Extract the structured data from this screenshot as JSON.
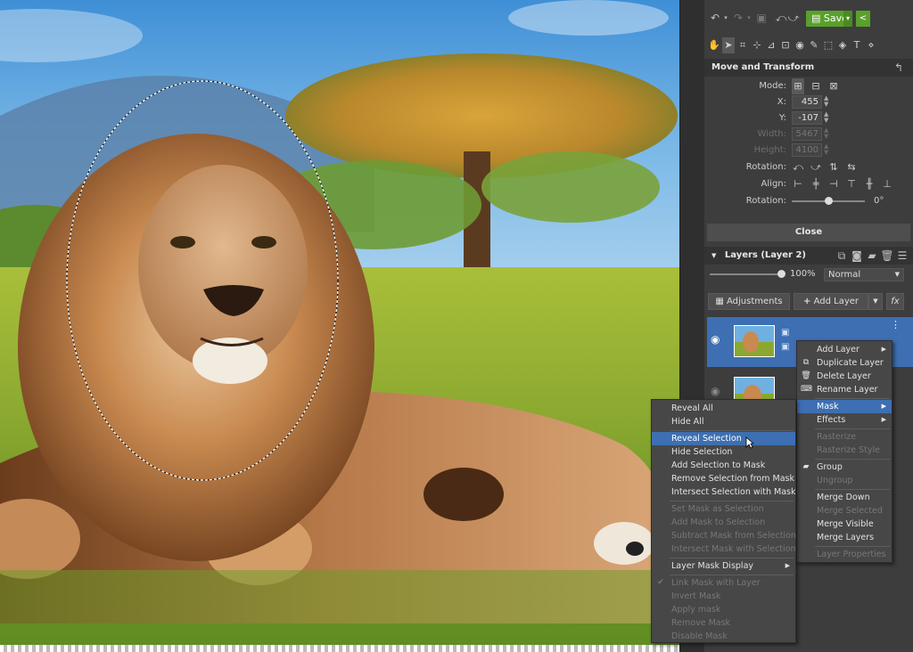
{
  "toolbar": {
    "save_label": "Save",
    "undo_icon": "undo-icon",
    "redo_icon": "redo-icon",
    "share_icon": "share-icon"
  },
  "move_transform": {
    "title": "Move and Transform",
    "mode_label": "Mode:",
    "x_label": "X:",
    "x_value": "455",
    "y_label": "Y:",
    "y_value": "-107",
    "width_label": "Width:",
    "width_value": "5467",
    "height_label": "Height:",
    "height_value": "4100",
    "rotation_label": "Rotation:",
    "align_label": "Align:",
    "rotation_slider_label": "Rotation:",
    "rotation_value": "0°",
    "rotation_level": 0.5,
    "close_label": "Close"
  },
  "layers": {
    "title": "Layers (Layer 2)",
    "opacity": "100%",
    "opacity_level": 1.0,
    "blend_mode": "Normal",
    "adjustments_label": "Adjustments",
    "add_layer_label": "Add Layer",
    "fx_label": "fx"
  },
  "context_menu": {
    "items": [
      {
        "label": "Add Layer",
        "submenu": true,
        "enabled": true
      },
      {
        "label": "Duplicate Layer",
        "enabled": true
      },
      {
        "label": "Delete Layer",
        "enabled": true
      },
      {
        "label": "Rename Layer",
        "enabled": true
      },
      {
        "label": "Mask",
        "submenu": true,
        "enabled": true,
        "highlighted": true
      },
      {
        "label": "Effects",
        "submenu": true,
        "enabled": true
      },
      {
        "label": "Rasterize",
        "enabled": false
      },
      {
        "label": "Rasterize Style",
        "enabled": false
      },
      {
        "label": "Group",
        "enabled": true
      },
      {
        "label": "Ungroup",
        "enabled": false
      },
      {
        "label": "Merge Down",
        "enabled": true
      },
      {
        "label": "Merge Selected",
        "enabled": false
      },
      {
        "label": "Merge Visible",
        "enabled": true
      },
      {
        "label": "Merge Layers",
        "enabled": true
      },
      {
        "label": "Layer Properties",
        "enabled": false
      }
    ]
  },
  "mask_menu": {
    "items": [
      {
        "label": "Reveal All",
        "enabled": true
      },
      {
        "label": "Hide All",
        "enabled": true
      },
      {
        "label": "Reveal Selection",
        "enabled": true,
        "highlighted": true
      },
      {
        "label": "Hide Selection",
        "enabled": true
      },
      {
        "label": "Add Selection to Mask",
        "enabled": true
      },
      {
        "label": "Remove Selection from Mask",
        "enabled": true
      },
      {
        "label": "Intersect Selection with Mask",
        "enabled": true
      },
      {
        "label": "Set Mask as Selection",
        "enabled": false
      },
      {
        "label": "Add Mask to Selection",
        "enabled": false
      },
      {
        "label": "Subtract Mask from Selection",
        "enabled": false
      },
      {
        "label": "Intersect Mask with Selection",
        "enabled": false
      },
      {
        "label": "Layer Mask Display",
        "enabled": true,
        "submenu": true
      },
      {
        "label": "Link Mask with Layer",
        "enabled": false,
        "checked": true
      },
      {
        "label": "Invert Mask",
        "enabled": false
      },
      {
        "label": "Apply mask",
        "enabled": false
      },
      {
        "label": "Remove Mask",
        "enabled": false
      },
      {
        "label": "Disable Mask",
        "enabled": false
      }
    ]
  },
  "colors": {
    "accent": "#3d6fb2",
    "save_green": "#5aa02c",
    "panel_bg": "#3d3d3d"
  }
}
